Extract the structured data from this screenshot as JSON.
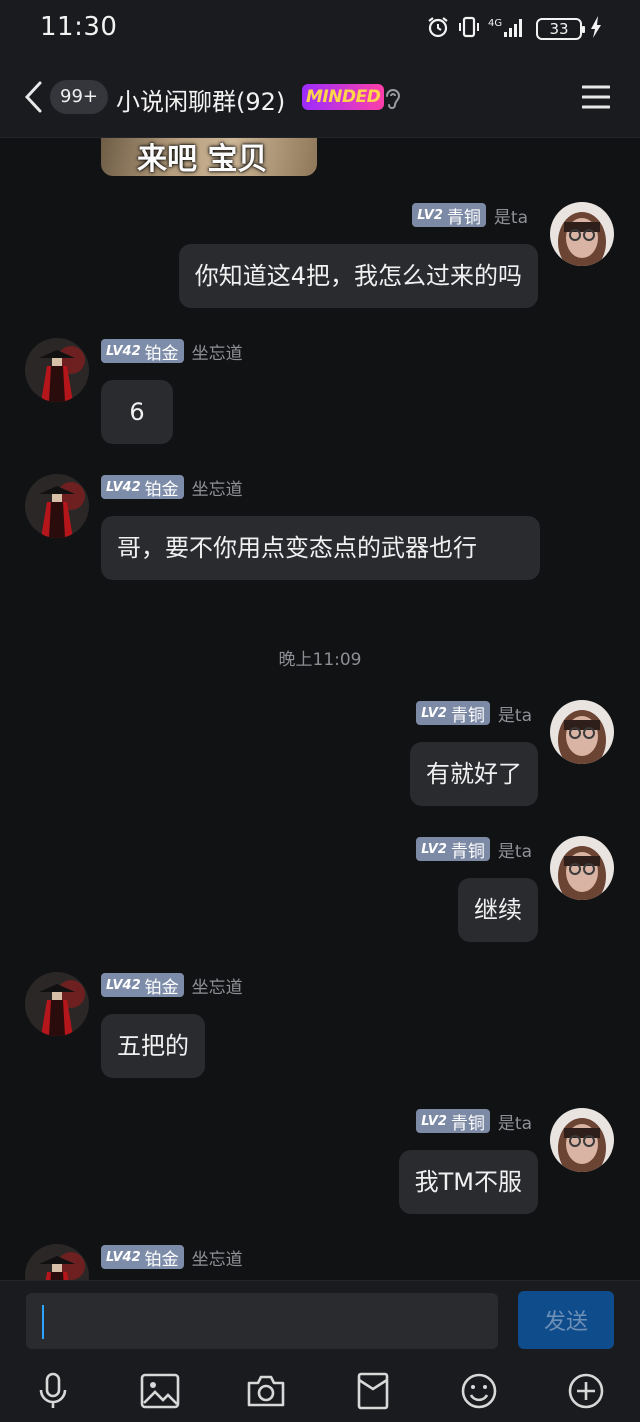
{
  "status_bar": {
    "time": "11:30",
    "battery": "33",
    "icons": [
      "alarm-icon",
      "vibrate-icon",
      "4g-signal-icon",
      "battery-icon",
      "charging-icon"
    ]
  },
  "header": {
    "unread_count": "99+",
    "title": "小说闲聊群(92)",
    "badge_text": "MINDED",
    "icons": [
      "back-arrow-icon",
      "ear-icon",
      "menu-icon"
    ]
  },
  "partial_image_caption": "来吧 宝贝",
  "messages": [
    {
      "side": "right",
      "level": "LV2",
      "rank": "青铜",
      "nick": "是ta",
      "text": "你知道这4把，我怎么过来的吗"
    },
    {
      "side": "left",
      "level": "LV42",
      "rank": "铂金",
      "nick": "坐忘道",
      "text": "6"
    },
    {
      "side": "left",
      "level": "LV42",
      "rank": "铂金",
      "nick": "坐忘道",
      "text": "哥，要不你用点变态点的武器也行"
    },
    {
      "side": "right",
      "level": "LV2",
      "rank": "青铜",
      "nick": "是ta",
      "text": "有就好了"
    },
    {
      "side": "right",
      "level": "LV2",
      "rank": "青铜",
      "nick": "是ta",
      "text": "继续"
    },
    {
      "side": "left",
      "level": "LV42",
      "rank": "铂金",
      "nick": "坐忘道",
      "text": "五把的"
    },
    {
      "side": "right",
      "level": "LV2",
      "rank": "青铜",
      "nick": "是ta",
      "text": "我TM不服"
    },
    {
      "side": "left",
      "level": "LV42",
      "rank": "铂金",
      "nick": "坐忘道",
      "text": ""
    }
  ],
  "timestamp": "晚上11:09",
  "composer": {
    "input_value": "",
    "send_label": "发送",
    "toolbar": [
      "microphone-icon",
      "image-icon",
      "camera-icon",
      "red-packet-icon",
      "emoji-icon",
      "plus-icon"
    ]
  },
  "colors": {
    "background": "#111214",
    "bubble": "#2a2b2f",
    "send_button": "#0f4c8c",
    "level_tag": "#7c8aa5"
  }
}
